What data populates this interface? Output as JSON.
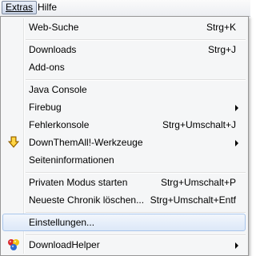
{
  "menubar": {
    "extras": "Extras",
    "hilfe": "Hilfe"
  },
  "menu": {
    "web_search": {
      "label": "Web-Suche",
      "shortcut": "Strg+K"
    },
    "downloads": {
      "label": "Downloads",
      "shortcut": "Strg+J"
    },
    "addons": {
      "label": "Add-ons"
    },
    "java_console": {
      "label": "Java Console"
    },
    "firebug": {
      "label": "Firebug"
    },
    "error_console": {
      "label": "Fehlerkonsole",
      "shortcut": "Strg+Umschalt+J"
    },
    "downthemall": {
      "label": "DownThemAll!-Werkzeuge"
    },
    "page_info": {
      "label": "Seiteninformationen"
    },
    "private_browsing": {
      "label": "Privaten Modus starten",
      "shortcut": "Strg+Umschalt+P"
    },
    "clear_history": {
      "label": "Neueste Chronik löschen...",
      "shortcut": "Strg+Umschalt+Entf"
    },
    "settings": {
      "label": "Einstellungen..."
    },
    "downloadhelper": {
      "label": "DownloadHelper"
    }
  },
  "icons": {
    "downthemall": "downthemall-arrow-icon",
    "downloadhelper": "downloadhelper-balls-icon"
  },
  "colors": {
    "hover_border": "#a9c6ec",
    "hover_fill": "#dce8f8",
    "menu_bg": "#f5f6f7"
  }
}
